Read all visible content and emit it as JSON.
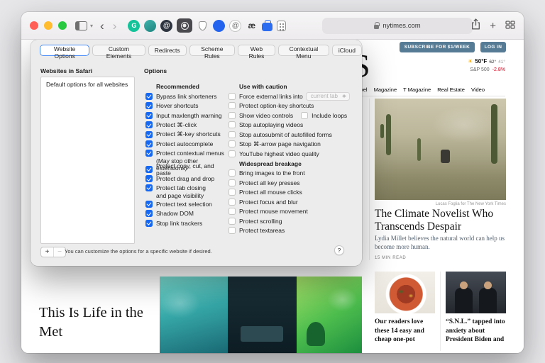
{
  "toolbar": {
    "url": "nytimes.com",
    "extensions": [
      {
        "name": "grammarly",
        "glyph": "G"
      },
      {
        "name": "teal",
        "glyph": ""
      },
      {
        "name": "at-dark",
        "glyph": "@"
      },
      {
        "name": "stop-the-madness",
        "glyph": ""
      },
      {
        "name": "shield",
        "glyph": ""
      },
      {
        "name": "blue",
        "glyph": ""
      },
      {
        "name": "at-gray",
        "glyph": "@"
      },
      {
        "name": "ae",
        "glyph": "æ"
      },
      {
        "name": "bag",
        "glyph": ""
      },
      {
        "name": "calculator",
        "glyph": ""
      }
    ]
  },
  "dialog": {
    "tabs": [
      "Website Options",
      "Custom Elements",
      "Redirects",
      "Scheme Rules",
      "Web Rules",
      "Contextual Menu",
      "iCloud"
    ],
    "selected_tab": "Website Options",
    "websites_header": "Websites in Safari",
    "website_items": [
      "Default options for all websites"
    ],
    "options_header": "Options",
    "recommended": {
      "header": "Recommended",
      "items": [
        {
          "label": "Bypass link shorteners",
          "checked": true
        },
        {
          "label": "Hover shortcuts",
          "checked": true
        },
        {
          "label": "Input maxlength warning",
          "checked": true
        },
        {
          "label": "Protect ⌘-click",
          "checked": true
        },
        {
          "label": "Protect ⌘-key shortcuts",
          "checked": true
        },
        {
          "label": "Protect autocomplete",
          "checked": true
        },
        {
          "label": "Protect contextual menus",
          "line2": "(May stop other extensions)",
          "checked": true
        },
        {
          "label": "Protect copy, cut, and paste",
          "checked": true
        },
        {
          "label": "Protect drag and drop",
          "checked": true
        },
        {
          "label": "Protect tab closing",
          "line2": "and page visibility",
          "checked": true
        },
        {
          "label": "Protect text selection",
          "checked": true
        },
        {
          "label": "Shadow DOM",
          "checked": true
        },
        {
          "label": "Stop link trackers",
          "checked": true
        }
      ]
    },
    "caution": {
      "header": "Use with caution",
      "items": [
        {
          "label": "Force external links into",
          "checked": false,
          "dropdown": "current tab"
        },
        {
          "label": "Protect option-key shortcuts",
          "checked": false
        },
        {
          "label": "Show video controls",
          "checked": false,
          "extra": "Include loops",
          "extra_checked": false
        },
        {
          "label": "Stop autoplaying videos",
          "checked": false
        },
        {
          "label": "Stop autosubmit of autofilled forms",
          "checked": false
        },
        {
          "label": "Stop ⌘-arrow page navigation",
          "checked": false
        },
        {
          "label": "YouTube highest video quality",
          "checked": false
        }
      ]
    },
    "breakage": {
      "header": "Widespread breakage",
      "items": [
        {
          "label": "Bring images to the front",
          "checked": false
        },
        {
          "label": "Protect all key presses",
          "checked": false
        },
        {
          "label": "Protect all mouse clicks",
          "checked": false
        },
        {
          "label": "Protect focus and blur",
          "checked": false
        },
        {
          "label": "Protect mouse movement",
          "checked": false
        },
        {
          "label": "Protect scrolling",
          "checked": false
        },
        {
          "label": "Protect textareas",
          "checked": false
        }
      ]
    },
    "footer": {
      "add": "+",
      "remove": "−",
      "hint": "You can customize the options for a specific website if desired.",
      "help": "?"
    }
  },
  "page": {
    "subscribe": "SUBSCRIBE FOR $1/WEEK",
    "login": "LOG IN",
    "weather": {
      "sun": "☀",
      "temp": "50°F",
      "high": "62°",
      "low": "41°"
    },
    "market": {
      "name": "S&P 500",
      "change": "-2.8%"
    },
    "masthead_letter": "S",
    "nav": [
      "vel",
      "Magazine",
      "T Magazine",
      "Real Estate",
      "Video"
    ],
    "lead": {
      "caption": "Lucas Foglia for The New York Times",
      "headline": "The Climate Novelist Who Transcends Despair",
      "deck": "Lydia Millet believes the natural world can help us become more human.",
      "read_time": "15 MIN READ"
    },
    "bottom": {
      "left_headline": "This Is Life in the Met",
      "teaser_food": "Our readers love these 14 easy and cheap one-pot",
      "teaser_snl": "“S.N.L.” tapped into anxiety about President Biden and"
    },
    "accent_colors": {
      "nyt_button_blue": "#567b95",
      "market_red": "#d0021b",
      "checkbox_blue": "#1667f2"
    }
  }
}
